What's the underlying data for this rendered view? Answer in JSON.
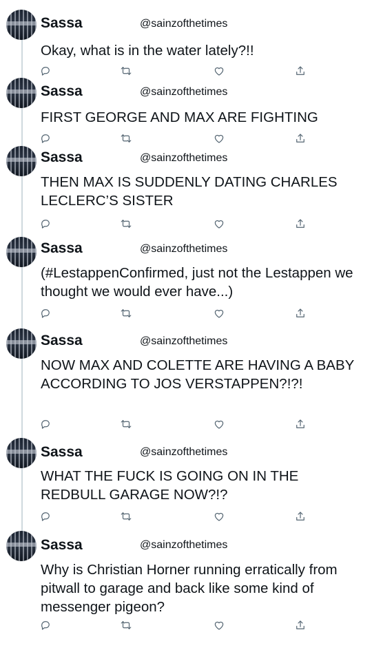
{
  "thread": {
    "tweets": [
      {
        "name": "Sassa",
        "handle": "@sainzofthetimes",
        "text": "Okay, what is in the water lately?!!"
      },
      {
        "name": "Sassa",
        "handle": "@sainzofthetimes",
        "text": "FIRST GEORGE AND MAX ARE FIGHTING"
      },
      {
        "name": "Sassa",
        "handle": "@sainzofthetimes",
        "text": "THEN MAX IS SUDDENLY DATING CHARLES LECLERC’S SISTER"
      },
      {
        "name": "Sassa",
        "handle": "@sainzofthetimes",
        "text": "(#LestappenConfirmed, just not the Lestappen we thought we would ever have...)"
      },
      {
        "name": "Sassa",
        "handle": "@sainzofthetimes",
        "text": "NOW MAX AND COLETTE ARE HAVING A BABY ACCORDING TO JOS VERSTAPPEN?!?!"
      },
      {
        "name": "Sassa",
        "handle": "@sainzofthetimes",
        "text": "WHAT THE FUCK IS GOING ON IN THE REDBULL GARAGE NOW?!?"
      },
      {
        "name": "Sassa",
        "handle": "@sainzofthetimes",
        "text": "Why is Christian Horner running erratically from pitwall to garage and back like some kind of messenger pigeon?"
      }
    ]
  },
  "icons": {
    "reply": "reply-icon",
    "retweet": "retweet-icon",
    "like": "like-icon",
    "share": "share-icon"
  },
  "colors": {
    "text": "#0f1419",
    "icon": "#536471",
    "thread_line": "#cfd9de"
  }
}
